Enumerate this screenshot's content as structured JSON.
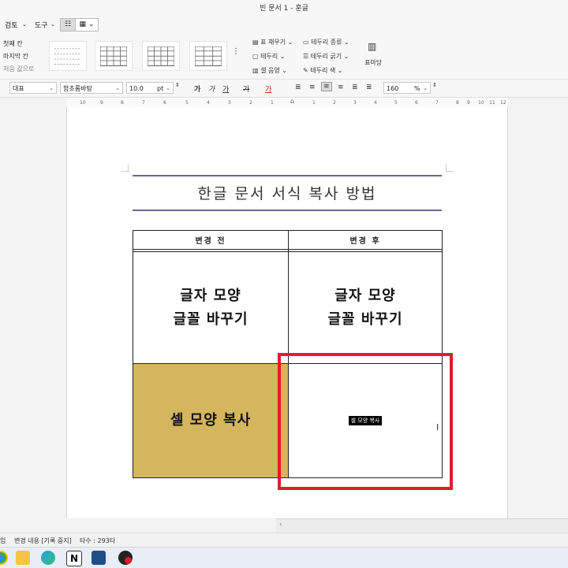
{
  "window": {
    "title": "빈 문서 1 - 훈글"
  },
  "menu": {
    "review": "검토",
    "tools": "도구"
  },
  "ribbon": {
    "cell_labels": [
      "첫째 칸",
      "마지막 칸",
      "처음 값으로"
    ],
    "table_cmds": [
      "표 채우기",
      "테두리",
      "셀 음영"
    ],
    "border_cmds": [
      "테두리 종류",
      "테두리 굵기",
      "테두리 색"
    ],
    "style_button": "표마당"
  },
  "format": {
    "style": "대표",
    "font": "함초롬바탕",
    "size": "10.0",
    "size_unit": "pt",
    "bold": "가",
    "italic": "가",
    "underline": "가",
    "strike": "가",
    "color": "가",
    "line_spacing": "160",
    "line_spacing_unit": "%"
  },
  "ruler": {
    "labels": [
      "10",
      "9",
      "8",
      "7",
      "6",
      "5",
      "4",
      "3",
      "2",
      "1",
      "1",
      "2",
      "3",
      "4",
      "5",
      "6",
      "7",
      "8",
      "9",
      "10",
      "11",
      "12"
    ]
  },
  "document": {
    "title": "한글 문서 서식 복사 방법",
    "table": {
      "header_left": "변경 전",
      "header_right": "변경 후",
      "row1_left": "글자 모양\n글꼴 바꾸기",
      "row1_right": "글자 모양\n글꼴 바꾸기",
      "row2_left": "셀 모양 복사",
      "row2_right": "셀 모양 복사"
    }
  },
  "status": {
    "mode": "입",
    "track": "변경 내용 [기록 중지]",
    "chars": "타수 : 293타"
  },
  "colors": {
    "title_rule": "#6b6494",
    "highlight_cell": "#d4b65e",
    "red_box": "#e11d2a"
  },
  "taskbar": {
    "icons": [
      "chrome-icon",
      "file-explorer-icon",
      "edge-icon",
      "notion-icon",
      "hwp-icon",
      "record-icon"
    ]
  }
}
